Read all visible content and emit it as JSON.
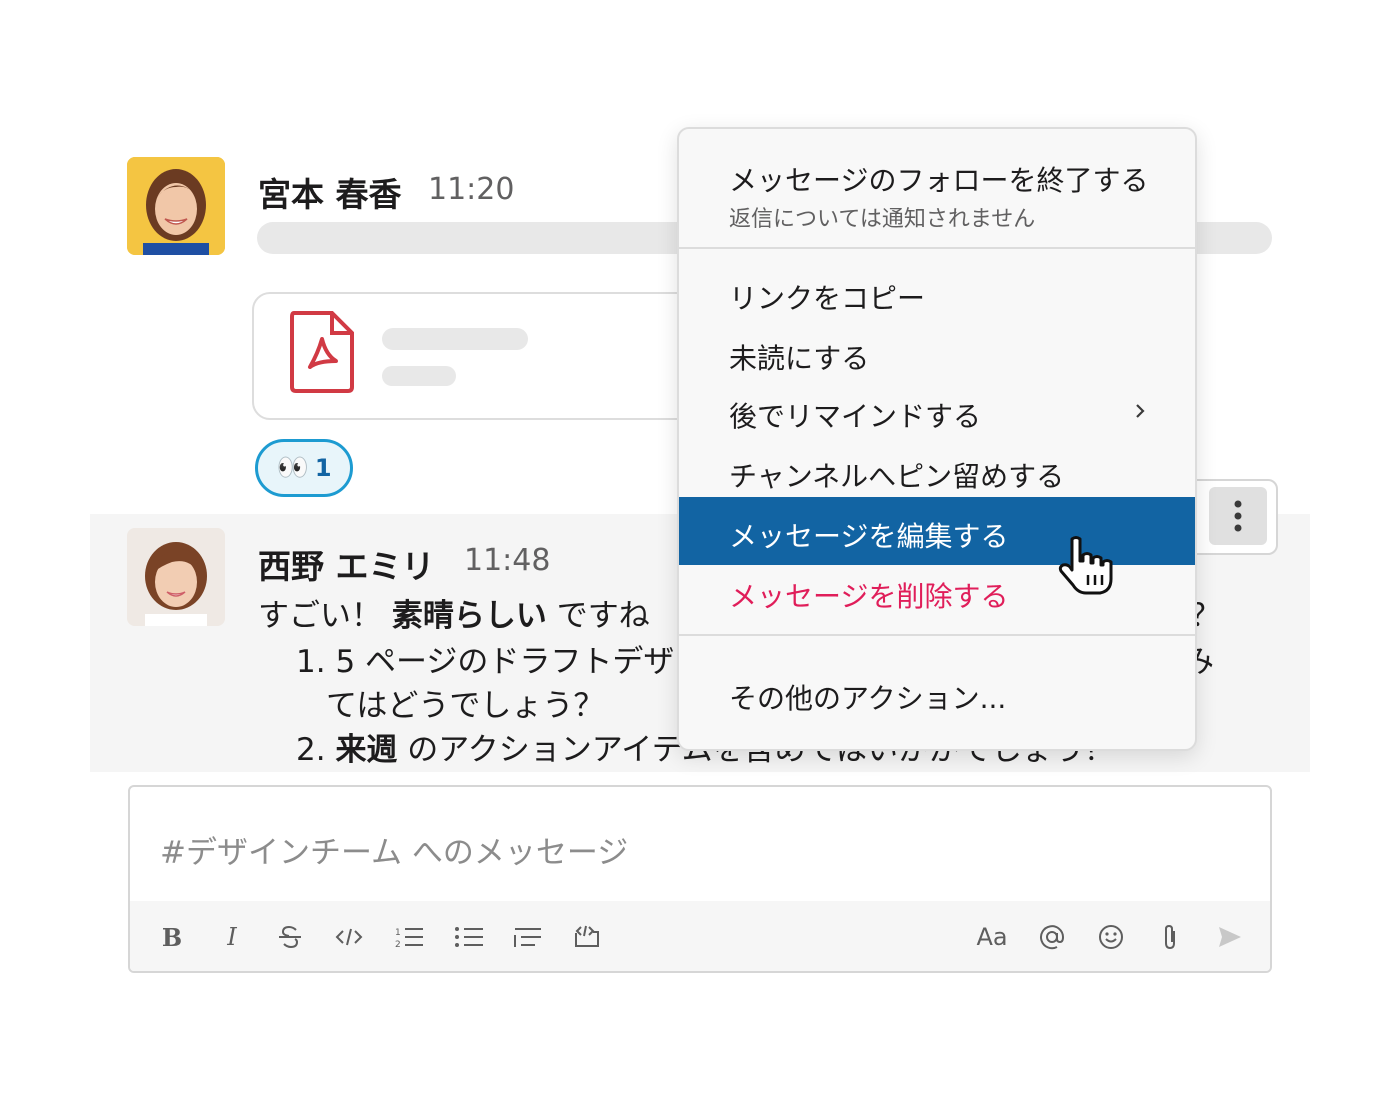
{
  "message1": {
    "author": "宮本 春香",
    "time": "11:20",
    "reaction_emoji": "👀",
    "reaction_count": "1"
  },
  "message2": {
    "author": "西野 エミリ",
    "time": "11:48",
    "line1_a": "すごい！",
    "line1_bold": "素晴らしい",
    "line1_b": "ですね",
    "line1_tail": "？",
    "item1_num": "1.",
    "item1_text": "5 ページのドラフトデザ",
    "item1_tail": "み",
    "item1_cont": "てはどうでしょう？",
    "item2_num": "2.",
    "item2_bold": "来週",
    "item2_text": "のアクションアイテムを含めてはいかがでしょう？"
  },
  "menu": {
    "follow_label": "メッセージのフォローを終了する",
    "follow_sub": "返信については通知されません",
    "copy_link": "リンクをコピー",
    "mark_unread": "未読にする",
    "remind_later": "後でリマインドする",
    "pin_channel": "チャンネルへピン留めする",
    "edit_message": "メッセージを編集する",
    "delete_message": "メッセージを削除する",
    "more_actions": "その他のアクション..."
  },
  "composer": {
    "placeholder": "#デザインチーム へのメッセージ",
    "format_text_label": "Aa"
  },
  "colors": {
    "selected": "#1264a3",
    "danger": "#e01e5a",
    "reaction_border": "#1d9bd1",
    "pdf": "#d13a44"
  },
  "icons": [
    "bold-icon",
    "italic-icon",
    "strikethrough-icon",
    "code-icon",
    "ordered-list-icon",
    "bullet-list-icon",
    "blockquote-icon",
    "code-block-icon",
    "mention-icon",
    "emoji-icon",
    "attachment-icon",
    "send-icon",
    "more-vertical-icon",
    "chevron-right-icon",
    "pdf-icon",
    "hand-cursor-icon"
  ]
}
